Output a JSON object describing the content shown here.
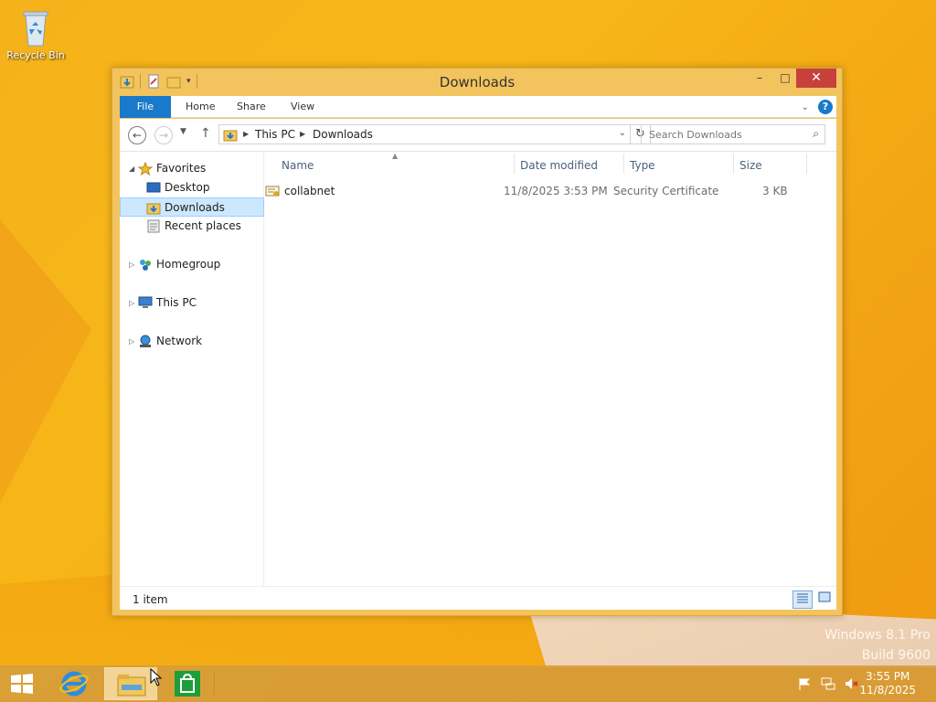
{
  "desktop": {
    "recycle_bin_label": "Recycle Bin",
    "watermark_line1": "Windows 8.1 Pro",
    "watermark_line2": "Build 9600"
  },
  "window": {
    "title": "Downloads",
    "controls": {
      "minimize": "–",
      "maximize": "□",
      "close": "✕"
    }
  },
  "ribbon": {
    "tabs": [
      {
        "label": "File"
      },
      {
        "label": "Home"
      },
      {
        "label": "Share"
      },
      {
        "label": "View"
      }
    ],
    "help": "?"
  },
  "navigation": {
    "breadcrumbs": [
      "This PC",
      "Downloads"
    ],
    "search_placeholder": "Search Downloads"
  },
  "nav_pane": {
    "favorites": "Favorites",
    "items": [
      {
        "label": "Desktop"
      },
      {
        "label": "Downloads"
      },
      {
        "label": "Recent places"
      }
    ],
    "homegroup": "Homegroup",
    "this_pc": "This PC",
    "network": "Network"
  },
  "file_list": {
    "columns": [
      "Name",
      "Date modified",
      "Type",
      "Size"
    ],
    "rows": [
      {
        "name": "collabnet",
        "date": "11/8/2025 3:53 PM",
        "type": "Security Certificate",
        "size": "3 KB"
      }
    ]
  },
  "status_bar": {
    "text": "1 item"
  },
  "taskbar": {
    "time": "3:55 PM",
    "date": "11/8/2025"
  },
  "colors": {
    "accent": "#1979ca",
    "window_frame": "#f3c45e",
    "close_button": "#c7413a",
    "selection": "#cce8ff"
  }
}
